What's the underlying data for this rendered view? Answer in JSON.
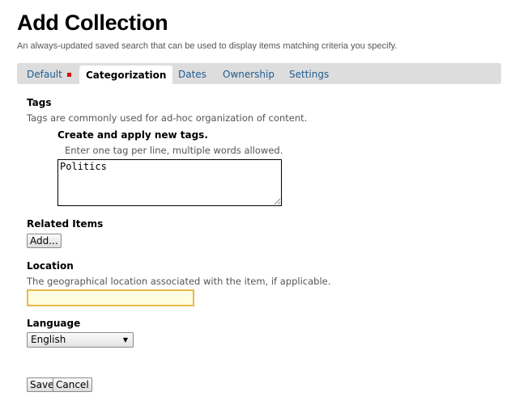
{
  "header": {
    "title": "Add Collection",
    "description": "An always-updated saved search that can be used to display items matching criteria you specify."
  },
  "tabs": [
    {
      "label": "Default",
      "required": true
    },
    {
      "label": "Categorization",
      "active": true
    },
    {
      "label": "Dates"
    },
    {
      "label": "Ownership"
    },
    {
      "label": "Settings"
    }
  ],
  "tags": {
    "label": "Tags",
    "help": "Tags are commonly used for ad-hoc organization of content.",
    "new_tags_label": "Create and apply new tags.",
    "new_tags_help": "Enter one tag per line, multiple words allowed.",
    "value": "Politics"
  },
  "related": {
    "label": "Related Items",
    "add_button": "Add..."
  },
  "location": {
    "label": "Location",
    "help": "The geographical location associated with the item, if applicable.",
    "value": ""
  },
  "language": {
    "label": "Language",
    "selected": "English"
  },
  "buttons": {
    "save": "Save",
    "cancel": "Cancel"
  },
  "colors": {
    "tab_link": "#205c90",
    "tab_bar": "#dddddd",
    "required_marker": "#dd0000",
    "focus_border": "#e8b84b",
    "focus_background": "#fffde1"
  },
  "icons": {
    "required_marker": "required-marker-icon",
    "dropdown": "chevron-down-icon",
    "resize": "resize-grip-icon"
  }
}
